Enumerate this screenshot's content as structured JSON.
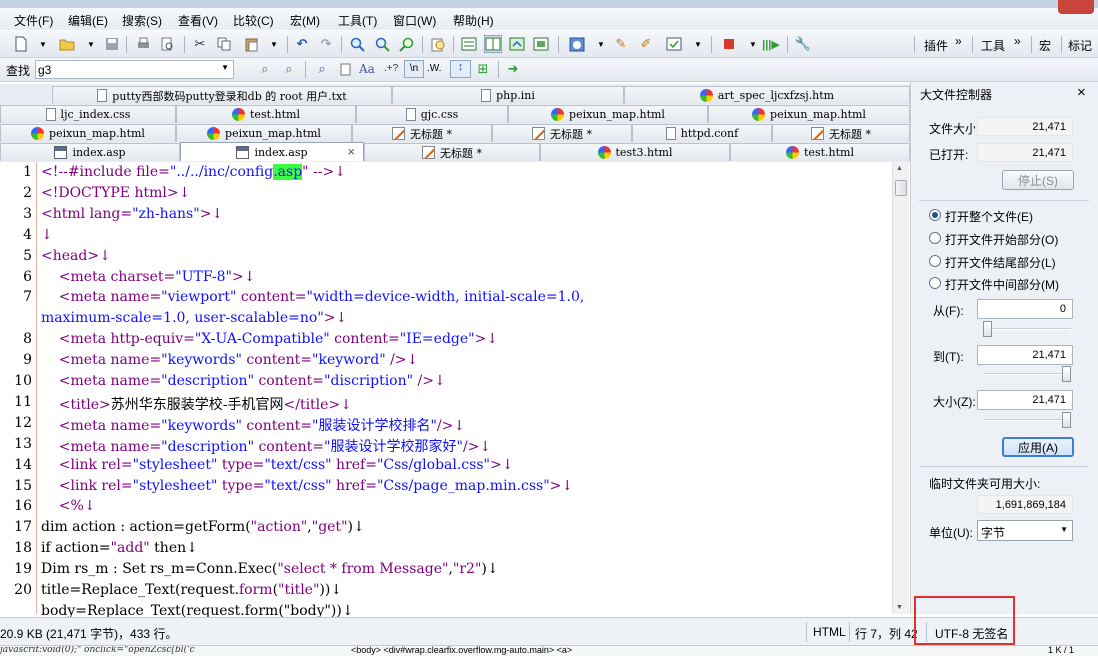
{
  "menu": [
    "文件(F)",
    "编辑(E)",
    "搜索(S)",
    "查看(V)",
    "比较(C)",
    "宏(M)",
    "工具(T)",
    "窗口(W)",
    "帮助(H)"
  ],
  "toolbar": {
    "plugins": "插件",
    "tools": "工具",
    "macro": "宏",
    "bookmark": "标记",
    "more": "»"
  },
  "find": {
    "label": "查找",
    "value": "g3",
    "regex_label": "\\n",
    "word_label": ".W.",
    "case_label": "Aa",
    "dot_label": ".+?"
  },
  "tabs": {
    "row1": [
      {
        "label": "putty西部数码putty登录和db 的 root 用户.txt",
        "icon": "doc"
      },
      {
        "label": "php.ini",
        "icon": "doc"
      },
      {
        "label": "art_spec_ljcxfzsj.htm",
        "icon": "ball"
      }
    ],
    "row2": [
      {
        "label": "ljc_index.css",
        "icon": "doc"
      },
      {
        "label": "test.html",
        "icon": "ball"
      },
      {
        "label": "gjc.css",
        "icon": "doc"
      },
      {
        "label": "peixun_map.html",
        "icon": "ball"
      },
      {
        "label": "peixun_map.html",
        "icon": "ball"
      }
    ],
    "row3": [
      {
        "label": "peixun_map.html",
        "icon": "ball"
      },
      {
        "label": "peixun_map.html",
        "icon": "ball"
      },
      {
        "label": "无标题 *",
        "icon": "note"
      },
      {
        "label": "无标题 *",
        "icon": "note"
      },
      {
        "label": "httpd.conf",
        "icon": "doc"
      },
      {
        "label": "无标题 *",
        "icon": "note"
      }
    ],
    "row4": [
      {
        "label": "index.asp",
        "icon": "asp"
      },
      {
        "label": "index.asp",
        "icon": "asp",
        "active": true,
        "close": "×"
      },
      {
        "label": "无标题 *",
        "icon": "note"
      },
      {
        "label": "test3.html",
        "icon": "ball"
      },
      {
        "label": "test.html",
        "icon": "ball"
      }
    ]
  },
  "editor": {
    "line_numbers": [
      "1",
      "2",
      "3",
      "4",
      "5",
      "6",
      "7",
      "",
      "8",
      "9",
      "10",
      "11",
      "12",
      "13",
      "14",
      "15",
      "16",
      "17",
      "18",
      "19",
      "20"
    ],
    "lines": [
      [
        [
          "<!--#include file=",
          "pk"
        ],
        [
          "\"../../inc/config",
          "bl"
        ],
        [
          ".asp",
          "hlbl"
        ],
        [
          "\" -->↓",
          "pk"
        ]
      ],
      [
        [
          "<!DOCTYPE html>↓",
          "pk"
        ]
      ],
      [
        [
          "<html lang=",
          "pk"
        ],
        [
          "\"zh-hans\"",
          "bl"
        ],
        [
          ">↓",
          "pk"
        ]
      ],
      [
        [
          "↓",
          "pk"
        ]
      ],
      [
        [
          "<head>↓",
          "pk"
        ]
      ],
      [
        [
          "    <meta charset=",
          "pk"
        ],
        [
          "\"UTF-8\"",
          "bl"
        ],
        [
          ">↓",
          "pk"
        ]
      ],
      [
        [
          "    <meta name=",
          "pk"
        ],
        [
          "\"viewport\"",
          "bl"
        ],
        [
          " content=",
          "pk"
        ],
        [
          "\"width=device-width, initial-scale=1.0,",
          "bl"
        ]
      ],
      [
        [
          "maximum-scale=1.0, user-scalable=no\"",
          "bl"
        ],
        [
          ">↓",
          "pk"
        ]
      ],
      [
        [
          "    <meta http-equiv=",
          "pk"
        ],
        [
          "\"X-UA-Compatible\"",
          "bl"
        ],
        [
          " content=",
          "pk"
        ],
        [
          "\"IE=edge\"",
          "bl"
        ],
        [
          ">↓",
          "pk"
        ]
      ],
      [
        [
          "    <meta name=",
          "pk"
        ],
        [
          "\"keywords\"",
          "bl"
        ],
        [
          " content=",
          "pk"
        ],
        [
          "\"keyword\"",
          "bl"
        ],
        [
          " />↓",
          "pk"
        ]
      ],
      [
        [
          "    <meta name=",
          "pk"
        ],
        [
          "\"description\"",
          "bl"
        ],
        [
          " content=",
          "pk"
        ],
        [
          "\"discription\"",
          "bl"
        ],
        [
          " />↓",
          "pk"
        ]
      ],
      [
        [
          "    <title>",
          "pk"
        ],
        [
          "苏州华东服装学校-手机官网",
          ""
        ],
        [
          "</title>↓",
          "pk"
        ]
      ],
      [
        [
          "    <meta name=",
          "pk"
        ],
        [
          "\"keywords\"",
          "bl"
        ],
        [
          " content=",
          "pk"
        ],
        [
          "\"服装设计学校排名\"",
          "bl"
        ],
        [
          "/>↓",
          "pk"
        ]
      ],
      [
        [
          "    <meta name=",
          "pk"
        ],
        [
          "\"description\"",
          "bl"
        ],
        [
          " content=",
          "pk"
        ],
        [
          "\"服装设计学校那家好\"",
          "bl"
        ],
        [
          "/>↓",
          "pk"
        ]
      ],
      [
        [
          "    <link rel=",
          "pk"
        ],
        [
          "\"stylesheet\"",
          "bl"
        ],
        [
          " type=",
          "pk"
        ],
        [
          "\"text/css\"",
          "bl"
        ],
        [
          " href=",
          "pk"
        ],
        [
          "\"Css/global.css\"",
          "bl"
        ],
        [
          ">↓",
          "pk"
        ]
      ],
      [
        [
          "    <link rel=",
          "pk"
        ],
        [
          "\"stylesheet\"",
          "bl"
        ],
        [
          " type=",
          "pk"
        ],
        [
          "\"text/css\"",
          "bl"
        ],
        [
          " href=",
          "pk"
        ],
        [
          "\"Css/page_map.min.css\"",
          "bl"
        ],
        [
          ">↓",
          "pk"
        ]
      ],
      [
        [
          "    <%↓",
          "pk"
        ]
      ],
      [
        [
          "dim action : action=getForm(",
          ""
        ],
        [
          "\"action\"",
          "pk"
        ],
        [
          ",",
          ""
        ],
        [
          "\"get\"",
          "pk"
        ],
        [
          ")↓",
          ""
        ]
      ],
      [
        [
          "if action=",
          ""
        ],
        [
          "\"add\"",
          "pk"
        ],
        [
          " then↓",
          ""
        ]
      ],
      [
        [
          "Dim rs_m : Set rs_m=Conn.Exec(",
          ""
        ],
        [
          "\"select * from Message\"",
          "pk"
        ],
        [
          ",",
          ""
        ],
        [
          "\"r2\"",
          "pk"
        ],
        [
          ")↓",
          ""
        ]
      ],
      [
        [
          "title=Replace_Text(request.",
          ""
        ],
        [
          "form",
          "pk"
        ],
        [
          "(",
          ""
        ],
        [
          "\"title\"",
          "pk"
        ],
        [
          "))↓",
          ""
        ]
      ],
      [
        [
          "body=Replace_Text(request.form(\"body\"))↓",
          ""
        ]
      ]
    ]
  },
  "panel": {
    "title": "大文件控制器",
    "close": "×",
    "file_size_label": "文件大小",
    "file_size": "21,471",
    "opened_label": "已打开:",
    "opened": "21,471",
    "stop_button": "停止(S)",
    "options": [
      "打开整个文件(E)",
      "打开文件开始部分(O)",
      "打开文件结尾部分(L)",
      "打开文件中间部分(M)"
    ],
    "selected_option": 0,
    "from_label": "从(F):",
    "from_value": "0",
    "from_level": 0,
    "to_label": "到(T):",
    "to_value": "21,471",
    "to_level": 1,
    "size_label": "大小(Z):",
    "size_value": "21,471",
    "size_level": 1,
    "apply_button": "应用(A)",
    "temp_label": "临时文件夹可用大小:",
    "temp_value": "1,691,869,184",
    "unit_label": "单位(U):",
    "unit_value": "字节"
  },
  "status": {
    "info": "20.9 KB (21,471 字节)，433 行。",
    "syntax": "HTML",
    "position": "行 7，列 42",
    "encoding": "UTF-8 无签名",
    "highlight_color": "#e03030"
  },
  "bottom": {
    "script": "javascrit:void(0);\" onclick=\"openZcsc[bl('c",
    "crumbs": "<body> <div#wrap.clearfix.overflow.mg-auto.main> <a>",
    "pages": "1 K / 1"
  }
}
